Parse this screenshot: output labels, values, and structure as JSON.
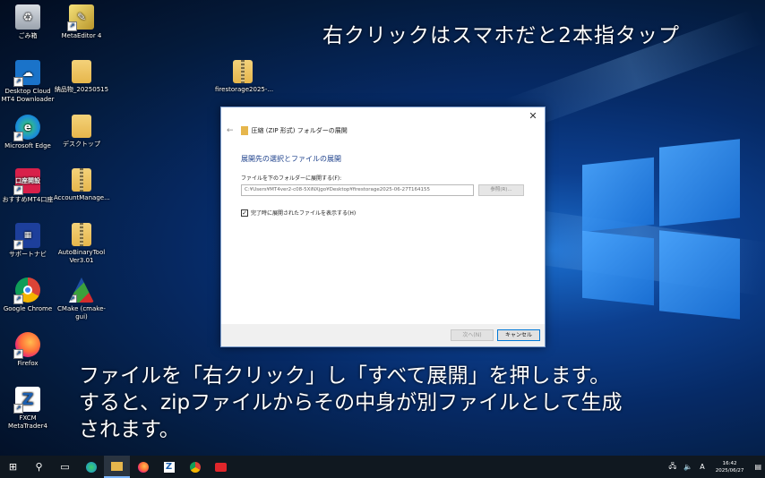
{
  "captions": {
    "top": "右クリックはスマホだと2本指タップ",
    "bottom_line1": "ファイルを「右クリック」し「すべて展開」を押します。",
    "bottom_line2": "すると、zipファイルからその中身が別ファイルとして生成",
    "bottom_line3": "されます。"
  },
  "desktop_icons": [
    {
      "label": "ごみ箱",
      "icon": "recycle-bin-icon"
    },
    {
      "label": "MetaEditor 4",
      "icon": "metaeditor-icon"
    },
    {
      "label": "Desktop Cloud MT4 Downloader",
      "icon": "desktop-cloud-icon"
    },
    {
      "label": "納品物_20250515",
      "icon": "folder-icon"
    },
    {
      "label": "firestorage2025-...",
      "icon": "zip-folder-icon"
    },
    {
      "label": "Microsoft Edge",
      "icon": "edge-icon"
    },
    {
      "label": "デスクトップ",
      "icon": "folder-icon"
    },
    {
      "label": "おすすめMT4口座",
      "icon": "account-open-icon",
      "badge": "口座開設"
    },
    {
      "label": "AccountManage...",
      "icon": "zip-folder-icon"
    },
    {
      "label": "サポートナビ",
      "icon": "support-navi-icon"
    },
    {
      "label": "AutoBinaryTool Ver3.01",
      "icon": "zip-folder-icon"
    },
    {
      "label": "Google Chrome",
      "icon": "chrome-icon"
    },
    {
      "label": "CMake (cmake-gui)",
      "icon": "cmake-icon"
    },
    {
      "label": "Firefox",
      "icon": "firefox-icon"
    },
    {
      "label": "FXCM MetaTrader4",
      "icon": "fxcm-icon"
    }
  ],
  "dialog": {
    "title": "圧縮 (ZIP 形式) フォルダーの展開",
    "heading": "展開先の選択とファイルの展開",
    "dest_label": "ファイルを下のフォルダーに展開する(F):",
    "dest_path": "C:¥Users¥MT4ver2-c08-5XiNXjgo¥Desktop¥firestorage2025-06-27T164155",
    "browse_label": "参照(R)...",
    "show_files_label": "完了時に展開されたファイルを表示する(H)",
    "show_files_checked": true,
    "next_label": "次へ(N)",
    "cancel_label": "キャンセル",
    "close_glyph": "✕",
    "back_glyph": "←"
  },
  "taskbar": {
    "items": [
      "start-icon",
      "search-icon",
      "task-view-icon",
      "edge-icon",
      "file-explorer-icon",
      "firefox-icon",
      "zoom-app-icon",
      "chrome-icon",
      "video-app-icon"
    ],
    "active_item": "file-explorer-icon",
    "ime_indicator": "A",
    "time": "16:42",
    "date": "2025/06/27"
  },
  "colors": {
    "accent": "#0078d7",
    "dialog_heading": "#1a3e8a",
    "taskbar": "#101820"
  }
}
